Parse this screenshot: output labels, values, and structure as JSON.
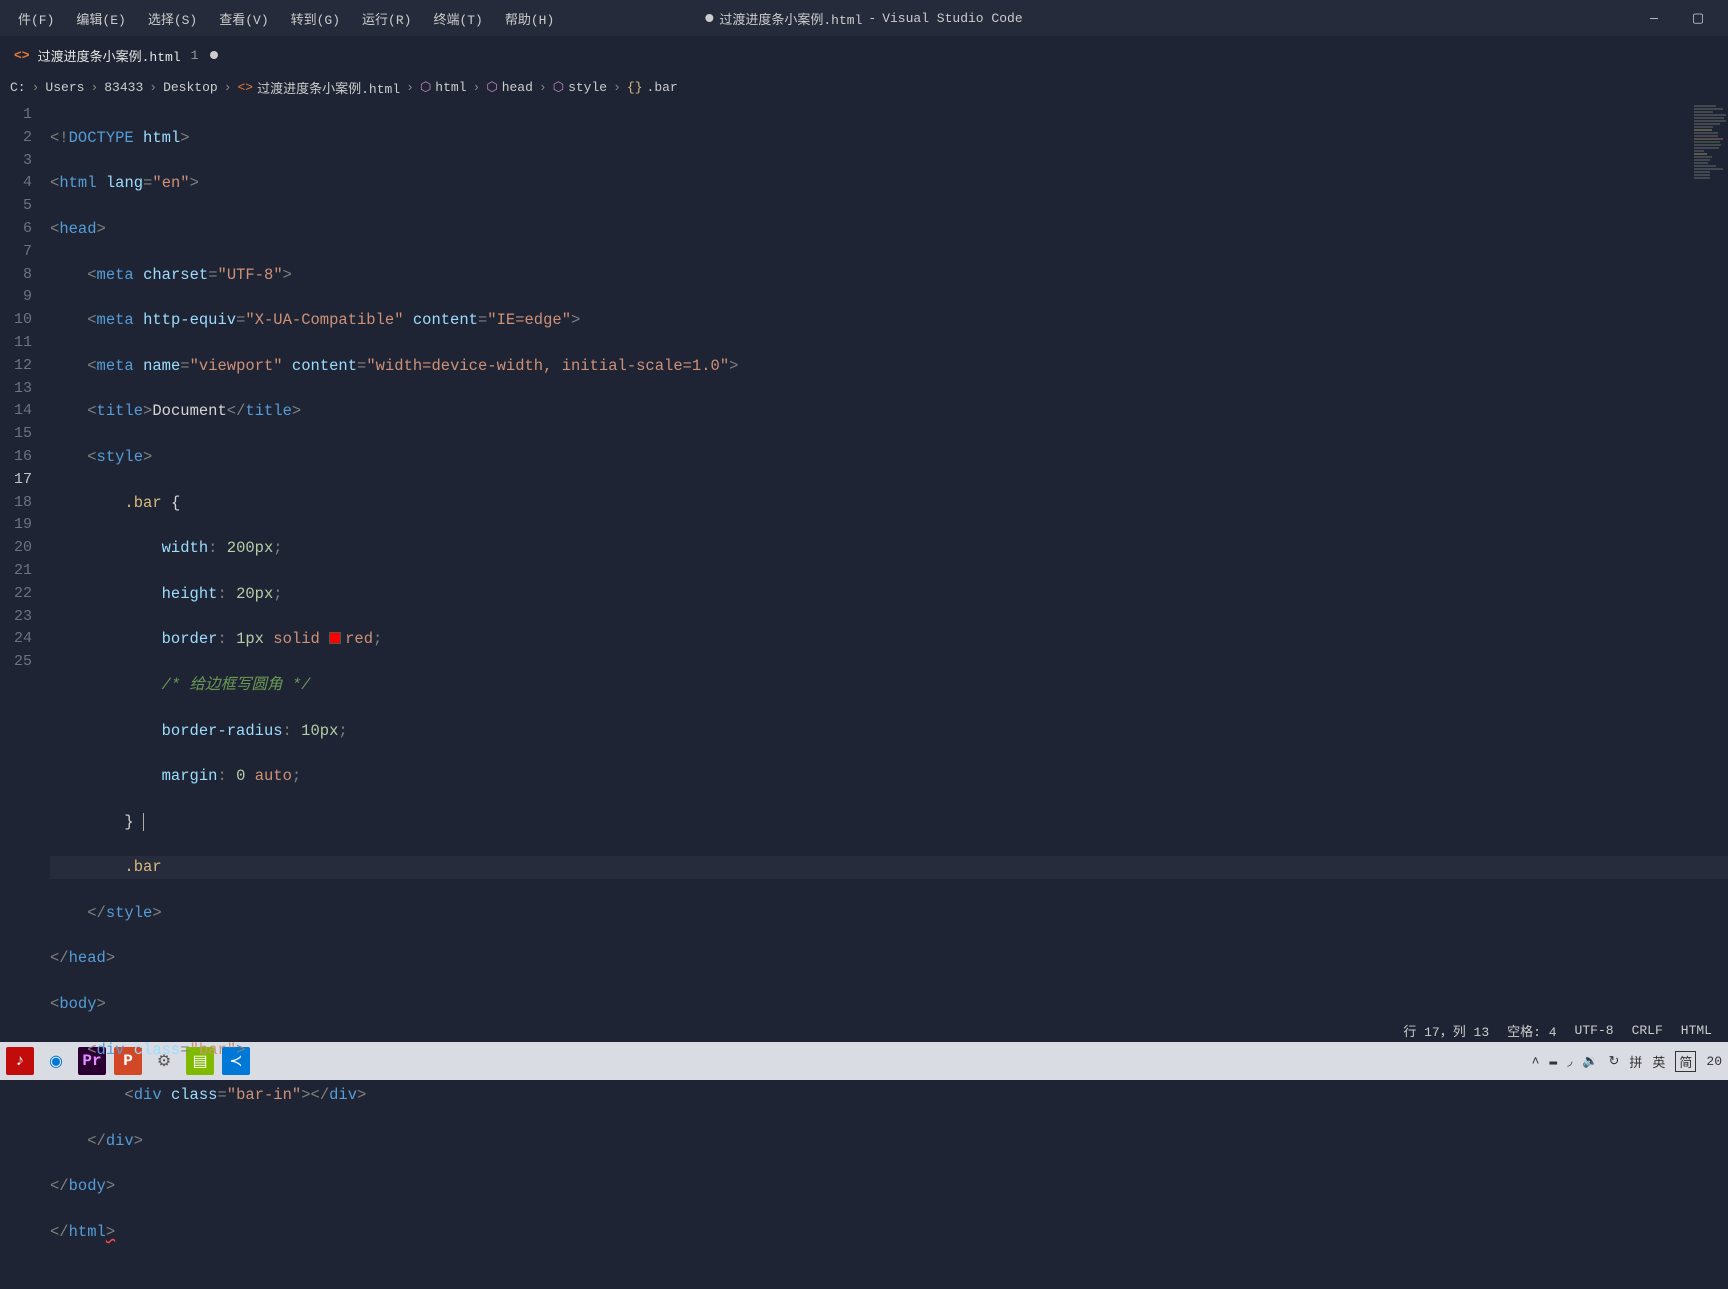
{
  "menu": {
    "items": [
      "件(F)",
      "编辑(E)",
      "选择(S)",
      "查看(V)",
      "转到(G)",
      "运行(R)",
      "终端(T)",
      "帮助(H)"
    ]
  },
  "title": {
    "filename": "过渡进度条小案例.html",
    "app": "Visual Studio Code"
  },
  "win_controls": {
    "min": "—",
    "max": "▢"
  },
  "tab": {
    "label": "过渡进度条小案例.html",
    "num": "1"
  },
  "breadcrumb": {
    "c0": "C:",
    "c1": "Users",
    "c2": "83433",
    "c3": "Desktop",
    "c4": "过渡进度条小案例.html",
    "c5": "html",
    "c6": "head",
    "c7": "style",
    "c8": ".bar"
  },
  "line_numbers": [
    "1",
    "2",
    "3",
    "4",
    "5",
    "6",
    "7",
    "8",
    "9",
    "10",
    "11",
    "12",
    "13",
    "14",
    "15",
    "16",
    "17",
    "18",
    "19",
    "20",
    "21",
    "22",
    "23",
    "24",
    "25"
  ],
  "code": {
    "title_text": "Document",
    "charset": "UTF-8",
    "compat": "IE=edge",
    "viewport": "width=device-width, initial-scale=1.0",
    "lang": "en",
    "sel": ".bar",
    "width_px": "200",
    "height_px": "20",
    "border_px": "1",
    "border_style": "solid",
    "border_color": "red",
    "radius_px": "10",
    "margin": "0 auto",
    "comment": "/* 给边框写圆角 */",
    "sel2": ".bar",
    "div_class": "bar",
    "div_inner_class": "bar-in"
  },
  "status": {
    "pos": "行 17，列 13",
    "spaces": "空格: 4",
    "encoding": "UTF-8",
    "eol": "CRLF",
    "lang": "HTML"
  },
  "tray": {
    "ime1": "拼",
    "ime2": "英",
    "ime3": "简",
    "clock": "20"
  }
}
